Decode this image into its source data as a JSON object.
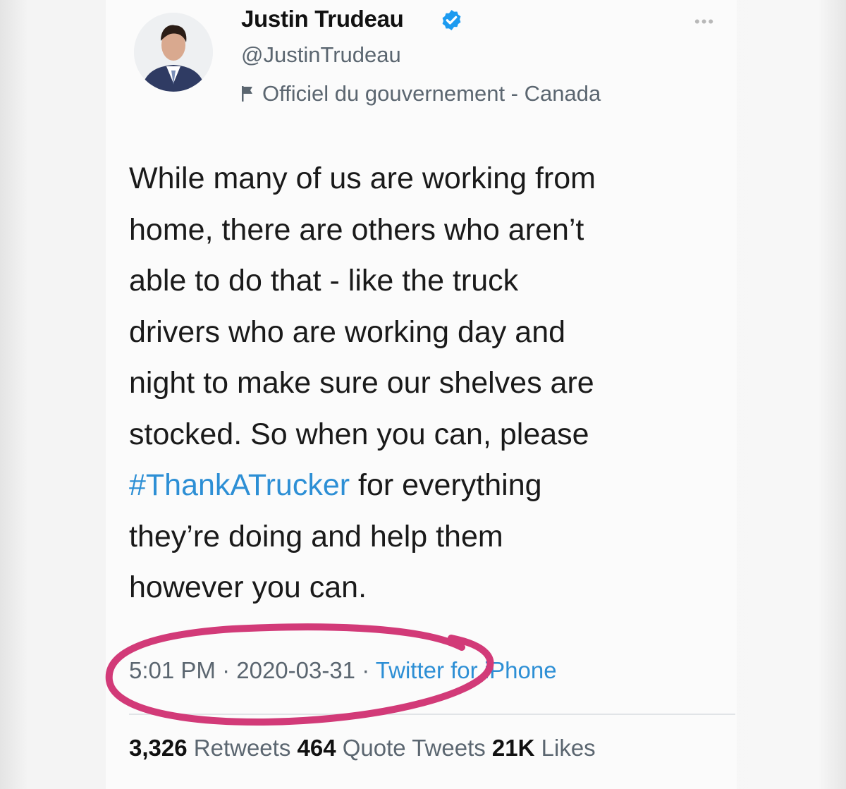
{
  "tweet": {
    "author": {
      "display_name": "Justin Trudeau",
      "handle": "@JustinTrudeau",
      "label": "Officiel du gouvernement - Canada",
      "verified": true
    },
    "more_icon": "more-dots-icon",
    "text": {
      "line1": "While many of us are working from",
      "line2": "home, there are others who aren’t",
      "line3": "able to do that - like the truck",
      "line4": "drivers who are working day and",
      "line5": "night to make sure our shelves are",
      "line6": "stocked. So when you can, please",
      "hashtag": "#ThankATrucker",
      "line7_rest": " for everything",
      "line8": "they’re doing and help them",
      "line9": "however you can."
    },
    "meta": {
      "time": "5:01 PM",
      "sep1": " · ",
      "date": "2020-03-31",
      "sep2": " · ",
      "source": "Twitter for iPhone"
    },
    "stats": {
      "retweets_count": "3,326",
      "retweets_label": "Retweets",
      "quotes_count": "464",
      "quotes_label": "Quote Tweets",
      "likes_count": "21K",
      "likes_label": "Likes"
    }
  },
  "annotation": {
    "color": "#d23a78",
    "shape": "hand-drawn-ellipse"
  }
}
